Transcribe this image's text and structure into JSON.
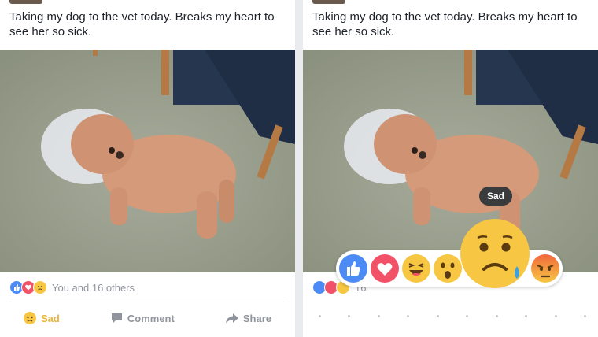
{
  "left_post": {
    "text": "Taking my dog to the vet today. Breaks my heart to see her so sick.",
    "reaction_summary": "You and 16 others",
    "actions": {
      "sad_label": "Sad",
      "comment_label": "Comment",
      "share_label": "Share"
    }
  },
  "right_post": {
    "text": "Taking my dog to the vet today. Breaks my heart to see her so sick.",
    "reaction_summary_partial": "16",
    "tooltip": "Sad",
    "reaction_options": [
      "like-icon",
      "love-icon",
      "haha-icon",
      "wow-icon",
      "sad-icon",
      "angry-icon"
    ]
  },
  "colors": {
    "like_blue": "#4c8bf5",
    "love_red": "#f25268",
    "sad_yellow": "#f7c744",
    "angry_red": "#f0683c",
    "active_sad_text": "#e9b43a"
  }
}
